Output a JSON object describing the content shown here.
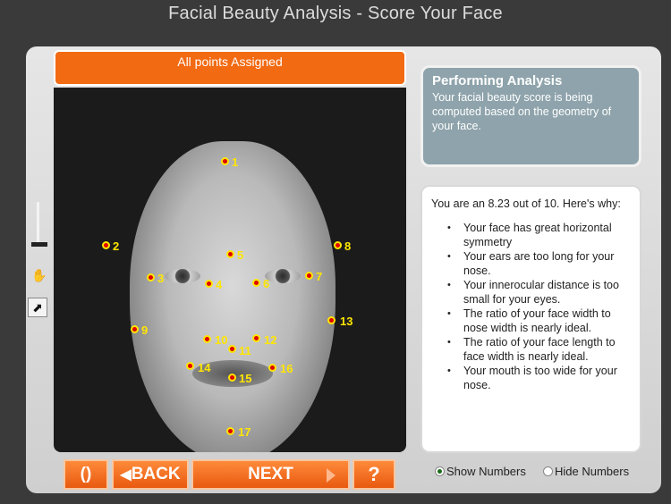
{
  "app_title": "Facial Beauty Analysis - Score Your Face",
  "status_bar": "All points Assigned",
  "analysis": {
    "title": "Performing Analysis",
    "body": "Your facial beauty score is being computed based on the geometry of your face."
  },
  "results": {
    "intro": "You are an 8.23 out of 10.  Here's why:",
    "items": [
      "Your face has great horizontal symmetry",
      "Your ears are too long for your nose.",
      "Your innerocular distance is too small for your eyes.",
      "The ratio of your face width to nose width is nearly ideal.",
      "The ratio of your face length to face width is nearly ideal.",
      "Your mouth is too wide for your nose."
    ]
  },
  "buttons": {
    "reset": "()",
    "back": "BACK",
    "next": "NEXT",
    "help": "?"
  },
  "radios": {
    "show": "Show Numbers",
    "hide": "Hide Numbers",
    "selected": "show"
  },
  "point_labels": [
    "1",
    "2",
    "3",
    "4",
    "5",
    "6",
    "7",
    "8",
    "9",
    "10",
    "11",
    "12",
    "13",
    "14",
    "15",
    "16",
    "17"
  ],
  "icons": {
    "hand": "hand-icon",
    "arrow": "pointer-arrow-icon",
    "refresh": "refresh-icon"
  },
  "colors": {
    "accent": "#f26a12",
    "point_fill": "#e00000",
    "point_ring": "#ffe600",
    "analysis_bg": "#8ea3ab"
  }
}
